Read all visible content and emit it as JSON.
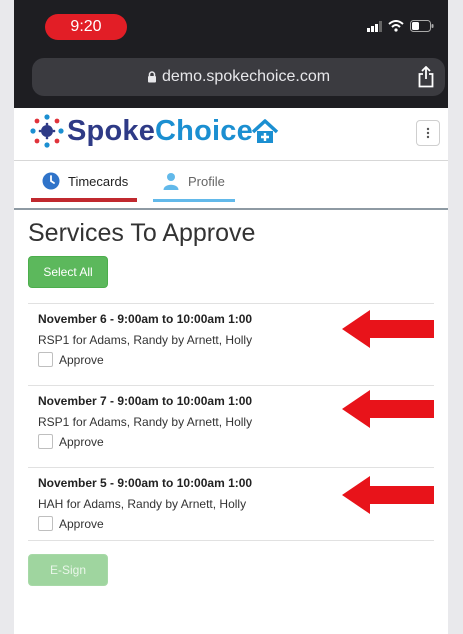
{
  "status_bar": {
    "time": "9:20"
  },
  "browser": {
    "url": "demo.spokechoice.com"
  },
  "header": {
    "logo_part1": "Spoke",
    "logo_part2": "Choice"
  },
  "tabs": [
    {
      "label": "Timecards",
      "active": true
    },
    {
      "label": "Profile",
      "active": false
    }
  ],
  "page": {
    "title": "Services To Approve",
    "select_all_label": "Select All",
    "esign_label": "E-Sign"
  },
  "services": [
    {
      "date": "November 6 - 9:00am to 10:00am 1:00",
      "description": "RSP1 for Adams, Randy by Arnett, Holly",
      "approve_label": "Approve",
      "checked": false
    },
    {
      "date": "November 7 - 9:00am to 10:00am 1:00",
      "description": "RSP1 for Adams, Randy by Arnett, Holly",
      "approve_label": "Approve",
      "checked": false
    },
    {
      "date": "November 5 - 9:00am to 10:00am 1:00",
      "description": "HAH for Adams, Randy by Arnett, Holly",
      "approve_label": "Approve",
      "checked": false
    }
  ],
  "colors": {
    "brand_dark": "#2e3a86",
    "brand_light": "#1b8fd1",
    "active_tab": "#c0292f",
    "button_green": "#5cb85c",
    "annotation_arrow": "#e8131a"
  },
  "icons": [
    "lock-icon",
    "share-icon",
    "home-icon",
    "kebab-icon",
    "clock-icon",
    "person-icon",
    "arrow-left-icon"
  ]
}
